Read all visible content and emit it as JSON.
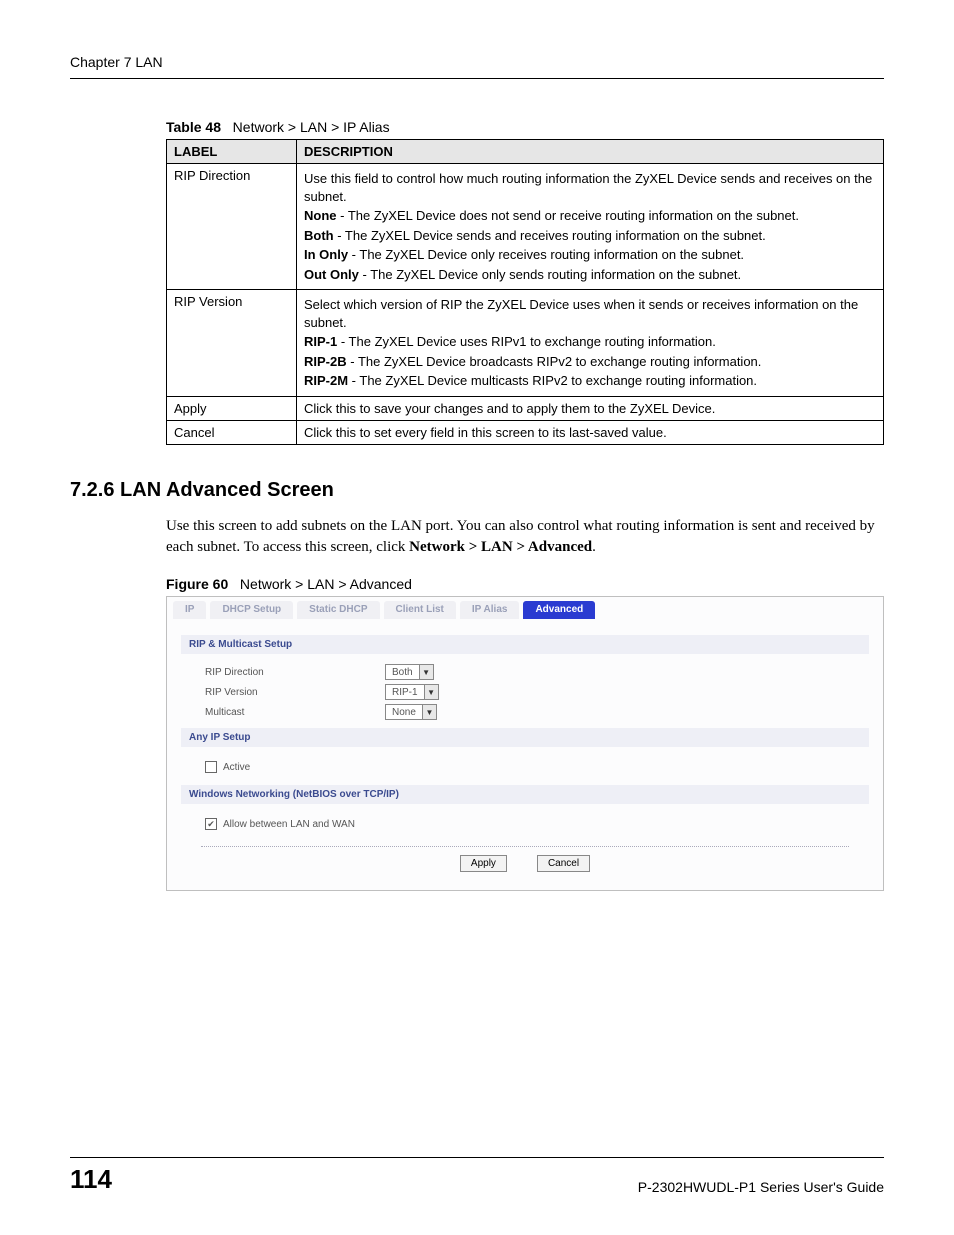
{
  "header": {
    "chapter": "Chapter 7 LAN"
  },
  "table": {
    "caption_label": "Table 48",
    "caption_text": "Network > LAN > IP Alias",
    "head": {
      "label": "LABEL",
      "desc": "DESCRIPTION"
    },
    "rows": {
      "rip_direction": {
        "label": "RIP Direction",
        "l1": "Use this field to control how much routing information the ZyXEL Device sends and receives on the subnet.",
        "none_b": "None",
        "none_t": " - The ZyXEL Device does not send or receive routing information on the subnet.",
        "both_b": "Both",
        "both_t": " - The ZyXEL Device sends and receives routing information on the subnet.",
        "inonly_b": "In Only",
        "inonly_t": " - The ZyXEL Device only receives routing information on the subnet.",
        "outonly_b": "Out Only",
        "outonly_t": " - The ZyXEL Device only sends routing information on the subnet."
      },
      "rip_version": {
        "label": "RIP Version",
        "l1": "Select which version of RIP the ZyXEL Device uses when it sends or receives information on the subnet.",
        "r1_b": "RIP-1",
        "r1_t": " - The ZyXEL Device uses RIPv1 to exchange routing information.",
        "r2b_b": "RIP-2B",
        "r2b_t": " - The ZyXEL Device broadcasts RIPv2 to exchange routing information.",
        "r2m_b": "RIP-2M",
        "r2m_t": " - The ZyXEL Device multicasts RIPv2 to exchange routing information."
      },
      "apply": {
        "label": "Apply",
        "desc": "Click this to save your changes and to apply them to the ZyXEL Device."
      },
      "cancel": {
        "label": "Cancel",
        "desc": "Click this to set every field in this screen to its last-saved value."
      }
    }
  },
  "section": {
    "heading": "7.2.6  LAN Advanced Screen",
    "body_pre": "Use this screen to add subnets on the LAN port. You can also control what routing information is sent and received by each subnet. To access this screen, click ",
    "body_bold": "Network > LAN > Advanced",
    "body_post": "."
  },
  "figure": {
    "caption_label": "Figure 60",
    "caption_text": "Network > LAN > Advanced",
    "tabs": {
      "ip": "IP",
      "dhcp": "DHCP Setup",
      "static": "Static DHCP",
      "client": "Client List",
      "alias": "IP Alias",
      "advanced": "Advanced"
    },
    "groups": {
      "rip": "RIP & Multicast Setup",
      "anyip": "Any IP Setup",
      "winnet": "Windows Networking (NetBIOS over TCP/IP)"
    },
    "fields": {
      "rip_direction": {
        "label": "RIP Direction",
        "value": "Both"
      },
      "rip_version": {
        "label": "RIP Version",
        "value": "RIP-1"
      },
      "multicast": {
        "label": "Multicast",
        "value": "None"
      },
      "active": "Active",
      "allow": "Allow between LAN and WAN"
    },
    "buttons": {
      "apply": "Apply",
      "cancel": "Cancel"
    }
  },
  "footer": {
    "page": "114",
    "guide": "P-2302HWUDL-P1 Series User's Guide"
  }
}
